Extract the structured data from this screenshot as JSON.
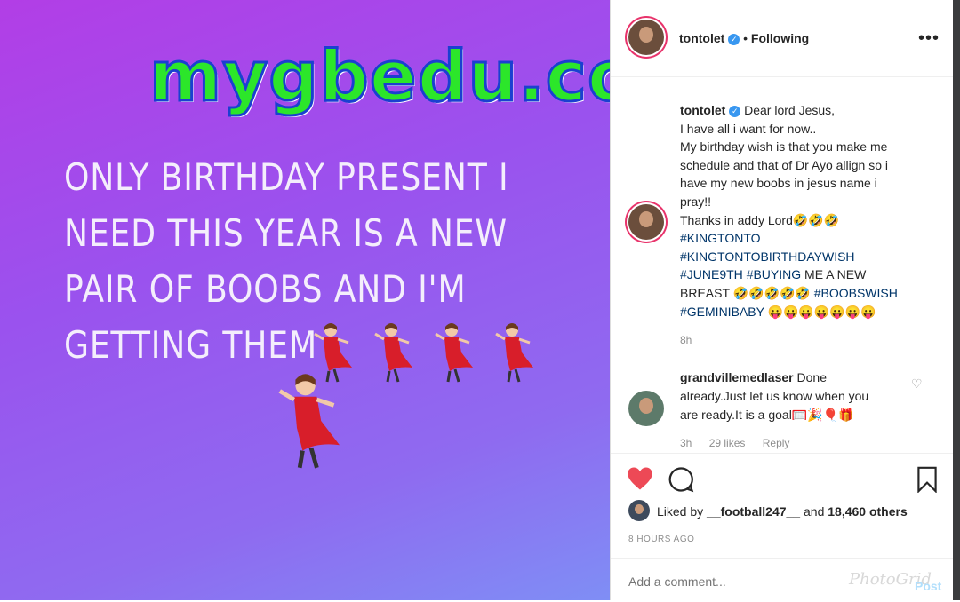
{
  "watermark": "mygbedu.com",
  "story": {
    "lines": [
      "ONLY BIRTHDAY PRESENT I",
      "NEED THIS YEAR IS A NEW",
      "PAIR OF BOOBS AND I'M",
      "GETTING THEM"
    ],
    "emoji_icon": "dancing-woman-icon"
  },
  "header": {
    "username": "tontolet",
    "separator": "•",
    "follow_status": "Following",
    "more_label": "•••"
  },
  "caption": {
    "username": "tontolet",
    "lines": [
      "Dear lord Jesus,",
      "I have all i want for now..",
      "My birthday wish is that you make me",
      "schedule and that of Dr Ayo allign so i",
      "have my new boobs in jesus name i",
      "pray!!",
      "Thanks in addy Lord🤣🤣🤣"
    ],
    "tag1": "#KINGTONTO",
    "tag2": "#KINGTONTOBIRTHDAYWISH",
    "tag3": "#JUNE9TH",
    "tag4": "#BUYING",
    "text_after_tag4": " ME A NEW",
    "text_breast": "BREAST 🤣🤣🤣🤣🤣 ",
    "tag5": "#BOOBSWISH",
    "tag6": "#GEMINIBABY",
    "text_end": " 😛😛😛😛😛😛😛",
    "time": "8h"
  },
  "comment": {
    "username": "grandvillemedlaser",
    "text1": " Done",
    "text2": "already.Just let us know when you",
    "text3": "are ready.It is a goal🥅🎉🎈🎁",
    "time": "3h",
    "likes": "29 likes",
    "reply": "Reply"
  },
  "actions": {
    "liked_by_prefix": "Liked by ",
    "liked_by_user": "__football247__",
    "liked_by_mid": " and ",
    "liked_by_count": "18,460 others",
    "time_ago": "8 HOURS AGO",
    "comment_placeholder": "Add a comment...",
    "post_label": "Post",
    "app_watermark": "PhotoGrid"
  },
  "colors": {
    "like_red": "#ed4956",
    "verified_blue": "#3897f0",
    "hashtag": "#003569",
    "story_gradient_top": "#b23ee6",
    "story_gradient_bottom": "#7f8ef5",
    "watermark_fill": "#2ce62a",
    "watermark_stroke": "#1b3fd1"
  }
}
